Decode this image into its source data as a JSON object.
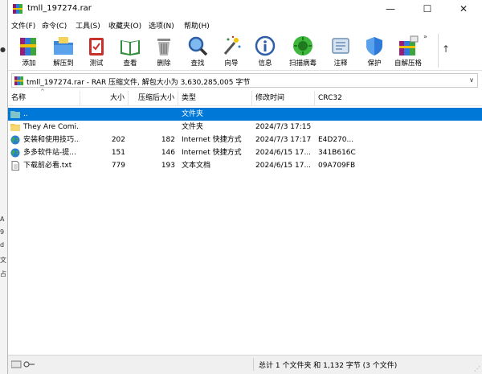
{
  "window": {
    "title": "tmll_197274.rar",
    "controls": {
      "minimize": "—",
      "maximize": "☐",
      "close": "✕"
    }
  },
  "background_glyphs": [
    "●",
    "A",
    "9",
    "d",
    "文",
    "占"
  ],
  "menu": [
    "文件(F)",
    "命令(C)",
    "工具(S)",
    "收藏夹(O)",
    "选项(N)",
    "帮助(H)"
  ],
  "toolbar": {
    "buttons": [
      {
        "label": "添加",
        "icon": "add-books-icon"
      },
      {
        "label": "解压到",
        "icon": "extract-folder-icon"
      },
      {
        "label": "测试",
        "icon": "test-clipboard-icon"
      },
      {
        "label": "查看",
        "icon": "view-book-icon"
      },
      {
        "label": "删除",
        "icon": "trash-icon"
      },
      {
        "label": "查找",
        "icon": "magnifier-icon"
      },
      {
        "label": "向导",
        "icon": "wizard-wand-icon"
      },
      {
        "label": "信息",
        "icon": "info-icon"
      },
      {
        "label": "扫描病毒",
        "icon": "virus-scan-icon"
      },
      {
        "label": "注释",
        "icon": "comment-icon"
      },
      {
        "label": "保护",
        "icon": "shield-icon"
      },
      {
        "label": "自解压格",
        "icon": "sfx-icon"
      }
    ],
    "more": "»",
    "up": "↑"
  },
  "address": {
    "text": "tmll_197274.rar - RAR 压缩文件, 解包大小为 3,630,285,005 字节",
    "dropdown": "∨"
  },
  "columns": [
    "名称",
    "大小",
    "压缩后大小",
    "类型",
    "修改时间",
    "CRC32"
  ],
  "rows": [
    {
      "name": "..",
      "size": "",
      "packed": "",
      "type": "文件夹",
      "modified": "",
      "crc": "",
      "icon": "parent-folder-icon",
      "selected": true
    },
    {
      "name": "They Are Comi...",
      "size": "",
      "packed": "",
      "type": "文件夹",
      "modified": "2024/7/3 17:15",
      "crc": "",
      "icon": "folder-icon",
      "selected": false
    },
    {
      "name": "安装和使用技巧....",
      "size": "202",
      "packed": "182",
      "type": "Internet 快捷方式",
      "modified": "2024/7/3 17:17",
      "crc": "E4D270...",
      "icon": "globe-icon",
      "selected": false
    },
    {
      "name": "多多软件站-提...",
      "size": "151",
      "packed": "146",
      "type": "Internet 快捷方式",
      "modified": "2024/6/15 17...",
      "crc": "341B616C",
      "icon": "globe-icon",
      "selected": false
    },
    {
      "name": "下载前必看.txt",
      "size": "779",
      "packed": "193",
      "type": "文本文档",
      "modified": "2024/6/15 17...",
      "crc": "09A709FB",
      "icon": "text-file-icon",
      "selected": false
    }
  ],
  "status": {
    "summary": "总计 1 个文件夹 和 1,132 字节 (3 个文件)"
  }
}
